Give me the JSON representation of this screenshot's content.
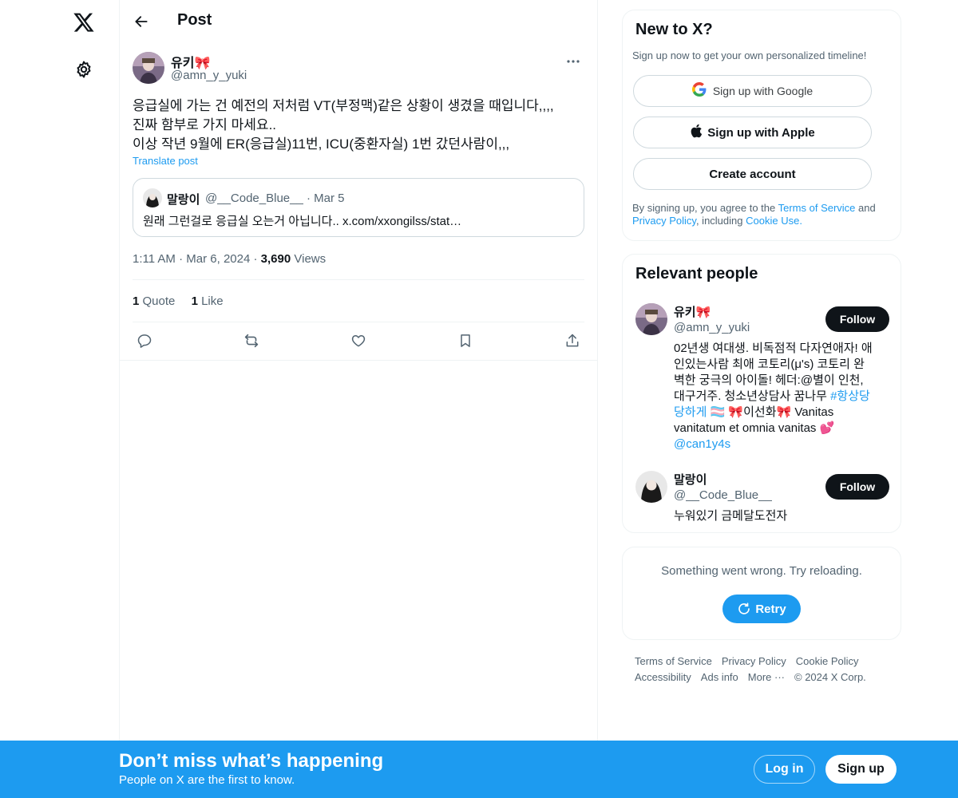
{
  "nav": {
    "logo_icon": "x-logo-icon",
    "settings_icon": "gear-icon"
  },
  "header": {
    "title": "Post"
  },
  "post": {
    "author_name": "유키🎀",
    "author_handle": "@amn_y_yuki",
    "lines": [
      "응급실에 가는 건 예전의 저처럼 VT(부정맥)같은 상황이 생겼을 때입니다,,,,",
      "진짜 함부로 가지 마세요..",
      "이상 작년 9월에 ER(응급실)11번, ICU(중환자실) 1번 갔던사람이,,,"
    ],
    "translate": "Translate post",
    "quote": {
      "name": "말랑이",
      "handle": "@__Code_Blue__",
      "separator": "·",
      "date": "Mar 5",
      "text": "원래 그런걸로 응급실 오는거 아닙니다.. x.com/xxongilss/stat…"
    },
    "time": "1:11 AM",
    "dot": "·",
    "date": "Mar 6, 2024",
    "views_count": "3,690",
    "views_label": "Views",
    "quotes_count": "1",
    "quotes_label": "Quote",
    "likes_count": "1",
    "likes_label": "Like"
  },
  "signup_card": {
    "title": "New to X?",
    "subtitle": "Sign up now to get your own personalized timeline!",
    "google": "Sign up with Google",
    "apple": "Sign up with Apple",
    "create": "Create account",
    "legal_1": "By signing up, you agree to the ",
    "terms": "Terms of Service",
    "legal_2": " and ",
    "privacy": "Privacy Policy",
    "legal_3": ", including ",
    "cookie": "Cookie Use",
    "legal_4": "."
  },
  "relevant": {
    "title": "Relevant people",
    "people": [
      {
        "name": "유키🎀",
        "handle": "@amn_y_yuki",
        "follow": "Follow",
        "bio_lines": [
          "02년생 여대생. 비독점적 다자연애자! 애",
          "인있는사람 최애 코토리(μ's) 코토리 완",
          "벽한 궁극의 아이돌! 헤더:@별이 인천,",
          "대구거주. 청소년상담사 꿈나무 "
        ],
        "hashtag_a": "#항상당",
        "hashtag_b": "당하게",
        "bio_after_tag": " 🏳️‍⚧️ 🎀이선화🎀 Vanitas",
        "bio_line6": "vanitatum et omnia vanitas 💕",
        "mention": "@can1y4s"
      },
      {
        "name": "말랑이",
        "handle": "@__Code_Blue__",
        "follow": "Follow",
        "bio": "누워있기 금메달도전자"
      }
    ]
  },
  "error_card": {
    "message": "Something went wrong. Try reloading.",
    "retry": "Retry"
  },
  "footer": {
    "links": [
      "Terms of Service",
      "Privacy Policy",
      "Cookie Policy",
      "Accessibility",
      "Ads info",
      "More ···",
      "© 2024 X Corp."
    ]
  },
  "banner": {
    "title": "Don’t miss what’s happening",
    "subtitle": "People on X are the first to know.",
    "login": "Log in",
    "signup": "Sign up"
  },
  "colors": {
    "accent": "#1d9bf0",
    "text": "#0f1419",
    "muted": "#536471",
    "border": "#eff3f4"
  }
}
